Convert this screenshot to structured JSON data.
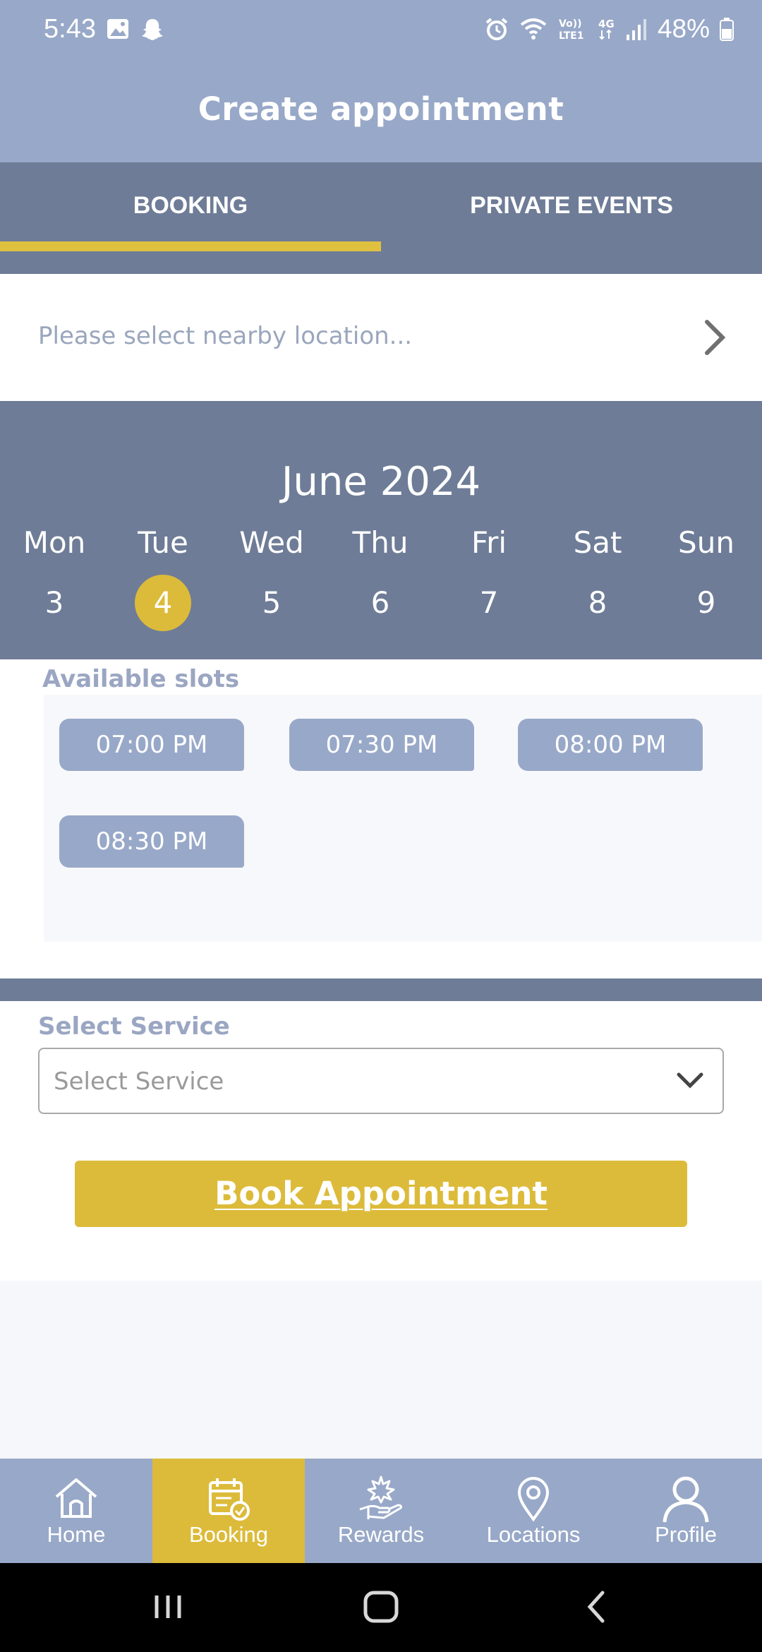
{
  "status_bar": {
    "time": "5:43",
    "battery": "48%",
    "icons": [
      "gallery-icon",
      "snapchat-icon",
      "alarm-icon",
      "wifi-icon",
      "volte-icon",
      "4g-icon",
      "signal-icon",
      "battery-icon"
    ]
  },
  "header": {
    "title": "Create appointment"
  },
  "tabs": {
    "items": [
      {
        "label": "BOOKING",
        "active": true
      },
      {
        "label": "PRIVATE EVENTS",
        "active": false
      }
    ],
    "accent": "#e0c13f"
  },
  "location": {
    "placeholder": "Please select nearby location..."
  },
  "calendar": {
    "month": "June 2024",
    "days": [
      {
        "name": "Mon",
        "num": "3"
      },
      {
        "name": "Tue",
        "num": "4",
        "selected": true
      },
      {
        "name": "Wed",
        "num": "5"
      },
      {
        "name": "Thu",
        "num": "6"
      },
      {
        "name": "Fri",
        "num": "7"
      },
      {
        "name": "Sat",
        "num": "8"
      },
      {
        "name": "Sun",
        "num": "9"
      }
    ]
  },
  "slots": {
    "title": "Available slots",
    "items": [
      "07:00 PM",
      "07:30 PM",
      "08:00 PM",
      "08:30 PM"
    ]
  },
  "service": {
    "label": "Select Service",
    "placeholder": "Select Service"
  },
  "book_button": {
    "label": "Book Appointment"
  },
  "bottom_nav": {
    "items": [
      {
        "label": "Home",
        "icon": "home-icon"
      },
      {
        "label": "Booking",
        "icon": "calendar-check-icon",
        "active": true
      },
      {
        "label": "Rewards",
        "icon": "rewards-icon"
      },
      {
        "label": "Locations",
        "icon": "location-pin-icon"
      },
      {
        "label": "Profile",
        "icon": "profile-icon"
      }
    ]
  },
  "colors": {
    "header": "#98a8c8",
    "dark_band": "#6e7c97",
    "accent": "#dcbb3a"
  }
}
